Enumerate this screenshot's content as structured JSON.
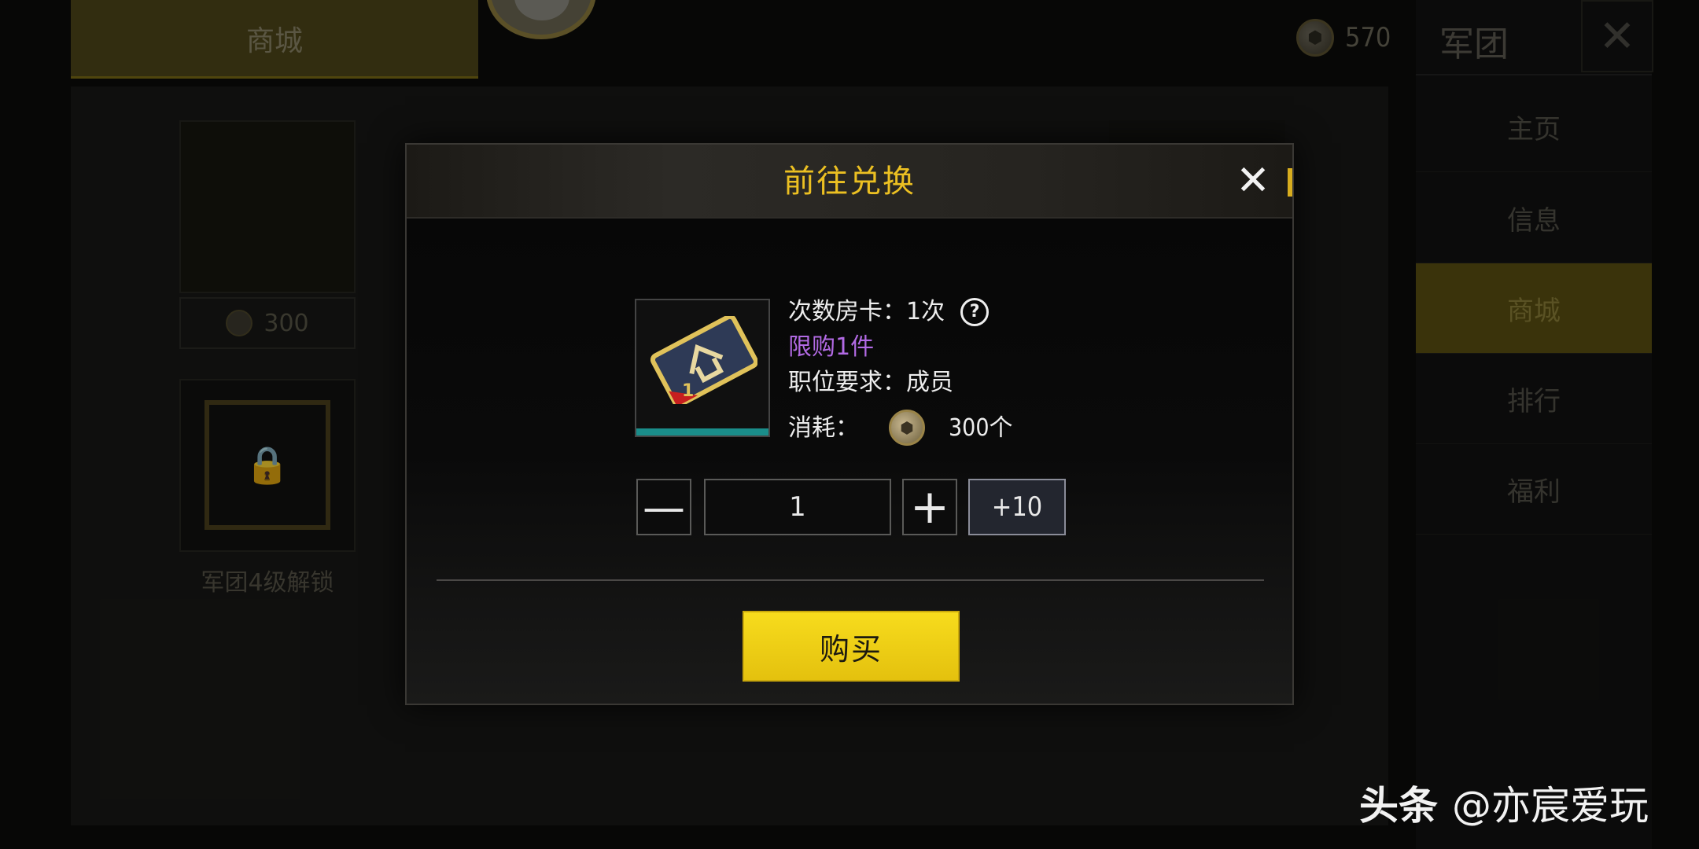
{
  "header": {
    "tab_shop": "商城",
    "currency_value": "570",
    "currency_icon": "guild-coin-icon"
  },
  "sidebar": {
    "title": "军团",
    "close_icon": "close-icon",
    "items": [
      {
        "label": "主页",
        "active": false
      },
      {
        "label": "信息",
        "active": false
      },
      {
        "label": "商城",
        "active": true
      },
      {
        "label": "排行",
        "active": false
      },
      {
        "label": "福利",
        "active": false
      }
    ]
  },
  "shop": {
    "first_item_price": "300",
    "locked_label": "军团4级解锁"
  },
  "modal": {
    "title": "前往兑换",
    "item_name": "次数房卡：1次",
    "limit": "限购1件",
    "requirement": "职位要求：成员",
    "cost_label": "消耗：",
    "cost_value": "300个",
    "quantity": "1",
    "minus_label": "—",
    "plus_label": "+",
    "plus10_label": "+10",
    "buy_label": "购买"
  },
  "watermark": {
    "brand": "头条",
    "handle": "@亦宸爱玩"
  },
  "colors": {
    "title_gold": "#ecc022",
    "buy_yellow": "#f7dc1d",
    "limit_purple": "#b26ae4",
    "item_bar_teal": "#1a8d8a"
  }
}
